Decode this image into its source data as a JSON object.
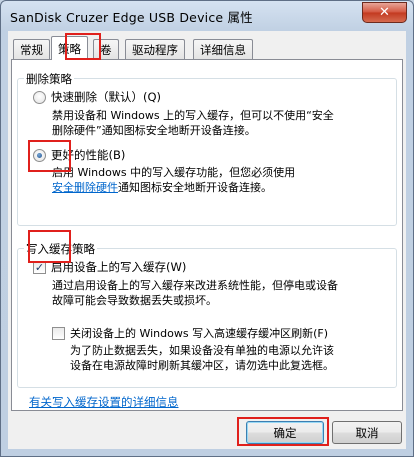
{
  "window": {
    "title": "SanDisk Cruzer Edge USB Device 属性",
    "close_symbol": "✕"
  },
  "tabs": [
    {
      "label": "常规"
    },
    {
      "label": "策略"
    },
    {
      "label": "卷"
    },
    {
      "label": "驱动程序"
    },
    {
      "label": "详细信息"
    }
  ],
  "active_tab": "策略",
  "removal_policy": {
    "legend": "删除策略",
    "quick_removal": {
      "label": "快速删除（默认）(Q)",
      "selected": false,
      "desc_line1": "禁用设备和 Windows 上的写入缓存，但可以不使用“安全",
      "desc_line2": "删除硬件”通知图标安全地断开设备连接。"
    },
    "better_performance": {
      "label": "更好的性能(B)",
      "selected": true,
      "desc_line1": "启用 Windows 中的写入缓存功能，但您必须使用",
      "desc_link": "安全删除硬件",
      "desc_line2_rest": "通知图标安全地断开设备连接。"
    }
  },
  "write_cache_policy": {
    "legend": "写入缓存策略",
    "enable_cache": {
      "label": "启用设备上的写入缓存(W)",
      "checked": true,
      "desc_line1": "通过启用设备上的写入缓存来改进系统性能，但停电或设备",
      "desc_line2": "故障可能会导致数据丢失或损坏。"
    },
    "turn_off_flush": {
      "label": "关闭设备上的 Windows 写入高速缓存缓冲区刷新(F)",
      "checked": false,
      "desc_line1": "为了防止数据丢失，如果设备没有单独的电源以允许该",
      "desc_line2": "设备在电源故障时刷新其缓冲区，请勿选中此复选框。"
    }
  },
  "details_link": "有关写入缓存设置的详细信息",
  "buttons": {
    "ok": "确定",
    "cancel": "取消"
  },
  "colors": {
    "highlight": "#e0201c",
    "link": "#0066cc",
    "titlebar": "#c5d3e3",
    "close_button": "#c2391f"
  }
}
